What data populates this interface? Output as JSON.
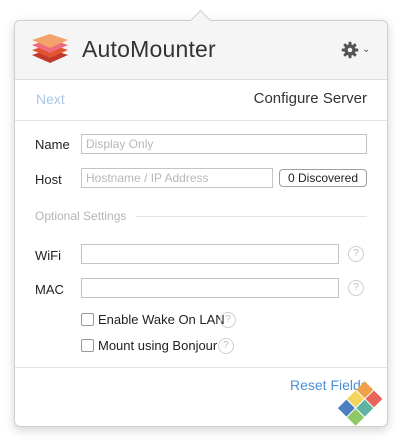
{
  "header": {
    "app_title": "AutoMounter"
  },
  "nav": {
    "next_label": "Next",
    "title": "Configure Server"
  },
  "form": {
    "name_label": "Name",
    "name_placeholder": "Display Only",
    "host_label": "Host",
    "host_placeholder": "Hostname / IP Address",
    "discovered_label": "0 Discovered",
    "optional_label": "Optional Settings",
    "wifi_label": "WiFi",
    "mac_label": "MAC",
    "wake_label": "Enable Wake On LAN",
    "bonjour_label": "Mount using Bonjour",
    "help_glyph": "?"
  },
  "footer": {
    "reset_label": "Reset Fields"
  },
  "icons": [
    "app-logo-icon",
    "gear-icon",
    "chevron-down-icon",
    "help-icon",
    "watermark-logo-icon"
  ],
  "colors": {
    "accent_blue": "#4a8fd9",
    "disabled_blue": "#a9c7ea",
    "placeholder_gray": "#b8b8b8"
  }
}
